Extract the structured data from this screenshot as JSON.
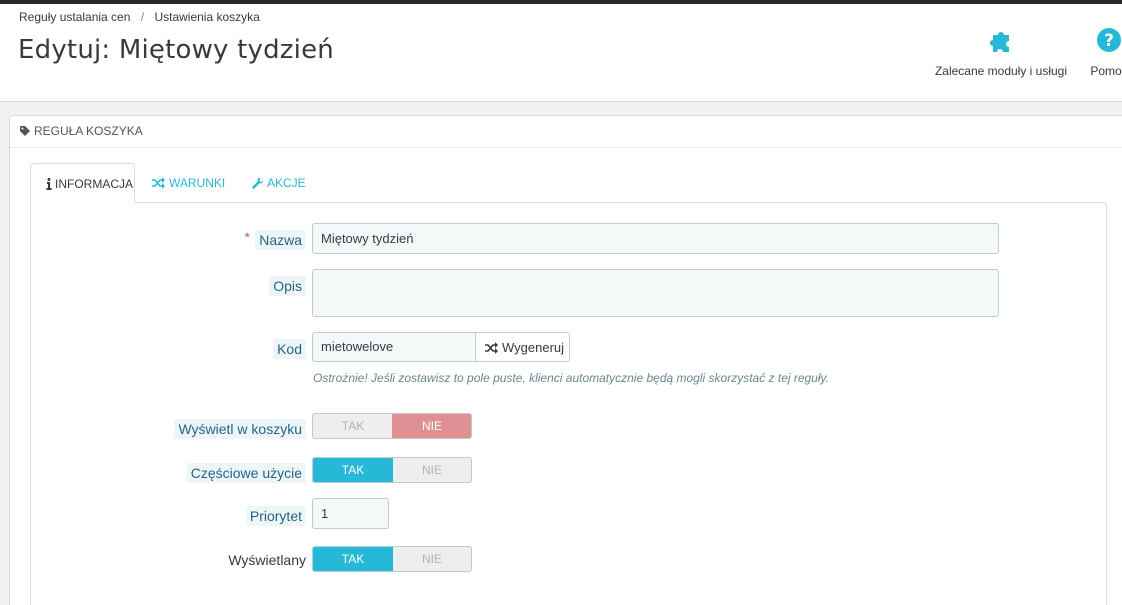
{
  "breadcrumb": {
    "items": [
      "Reguły ustalania cen",
      "Ustawienia koszyka"
    ]
  },
  "page": {
    "title": "Edytuj: Miętowy tydzień"
  },
  "toolbar": {
    "modules_label": "Zalecane moduły i usługi",
    "help_label": "Pomoc",
    "modules_icon": "puzzle-icon",
    "help_icon": "question-icon"
  },
  "panel": {
    "heading": "REGUŁA KOSZYKA",
    "heading_icon": "tag-icon"
  },
  "tabs": [
    {
      "label": "INFORMACJA",
      "icon": "info-icon",
      "active": true
    },
    {
      "label": "WARUNKI",
      "icon": "shuffle-icon",
      "active": false
    },
    {
      "label": "AKCJE",
      "icon": "wrench-icon",
      "active": false
    }
  ],
  "form": {
    "required_mark": "*",
    "name": {
      "label": "Nazwa",
      "value": "Miętowy tydzień"
    },
    "description": {
      "label": "Opis",
      "value": ""
    },
    "code": {
      "label": "Kod",
      "value": "mietowelove",
      "generate_label": "Wygeneruj",
      "help": "Ostrożnie! Jeśli zostawisz to pole puste, klienci automatycznie będą mogli skorzystać z tej reguły."
    },
    "show_in_cart": {
      "label": "Wyświetl w koszyku",
      "yes": "TAK",
      "no": "NIE",
      "selected": "no"
    },
    "partial_use": {
      "label": "Częściowe użycie",
      "yes": "TAK",
      "no": "NIE",
      "selected": "yes"
    },
    "priority": {
      "label": "Priorytet",
      "value": "1"
    },
    "active": {
      "label": "Wyświetlany",
      "yes": "TAK",
      "no": "NIE",
      "selected": "yes"
    }
  },
  "colors": {
    "accent": "#25b9d7",
    "danger_switch": "#e08f95",
    "text": "#363a41"
  }
}
